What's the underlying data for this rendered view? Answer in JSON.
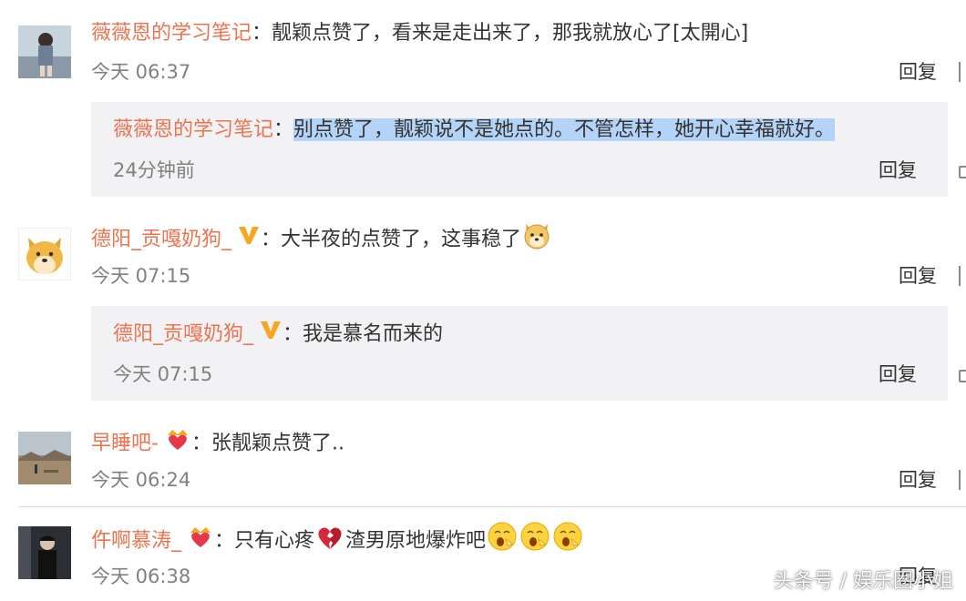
{
  "comments": [
    {
      "user": "薇薇恩的学习笔记",
      "colon": "：",
      "text": "靓颖点赞了，看来是走出来了，那我就放心了[太開心]",
      "time": "今天 06:37",
      "reply": "回复",
      "avatar_icon": "avatar-photo-girl-icon",
      "sub_reply": {
        "user": "薇薇恩的学习笔记",
        "colon": "：",
        "text": "别点赞了，靓颖说不是她点的。不管怎样，她开心幸福就好。",
        "time": "24分钟前",
        "reply": "回复",
        "highlighted": true
      }
    },
    {
      "user": "德阳_贡嘎奶狗_",
      "colon": "：",
      "text": "大半夜的点赞了，这事稳了",
      "time": "今天 07:15",
      "reply": "回复",
      "avatar_icon": "avatar-doge-icon",
      "badge_icon": "v-badge-icon",
      "trailing_emoji": "doge-emoji-icon",
      "sub_reply": {
        "user": "德阳_贡嘎奶狗_",
        "colon": "：",
        "text": "我是慕名而来的",
        "time": "今天 07:15",
        "reply": "回复",
        "badge_icon": "v-badge-icon"
      }
    },
    {
      "user": "早睡吧-",
      "colon": "：",
      "text": "张靓颖点赞了..",
      "time": "今天 06:24",
      "reply": "回复",
      "avatar_icon": "avatar-desert-landscape-icon",
      "badge_icon": "crown-heart-badge-icon"
    },
    {
      "user": "仵啊慕涛_",
      "colon": "：",
      "text_a": "只有心疼",
      "text_b": "渣男原地爆炸吧",
      "time": "今天 06:38",
      "reply": "回复",
      "avatar_icon": "avatar-photo-man-icon",
      "badge_icon": "crown-heart-badge-icon",
      "inline_emoji": "broken-heart-emoji-icon",
      "trailing_emojis": [
        "yawn-face-emoji-icon",
        "yawn-face-emoji-icon",
        "yawn-face-emoji-icon"
      ]
    }
  ],
  "watermark": "头条号 / 娱乐圈小姐",
  "colors": {
    "username": "#eb7350",
    "time": "#808080",
    "sub_bg": "#f2f2f5",
    "highlight": "#b3d3f7",
    "v_badge": "#f5a623"
  }
}
